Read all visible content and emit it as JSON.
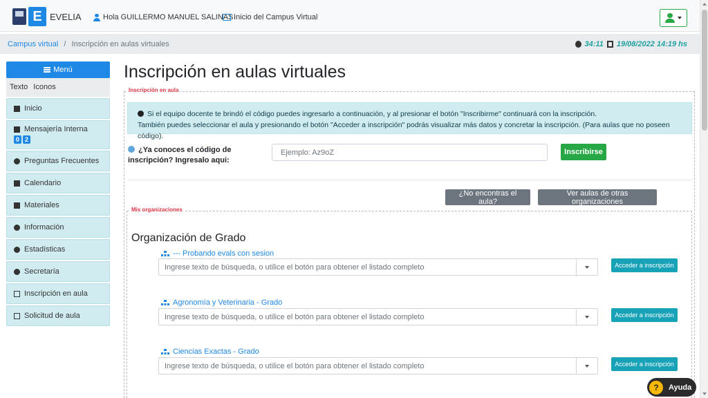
{
  "header": {
    "brand": "EVELIA",
    "greeting": "Hola GUILLERMO MANUEL SALINAS",
    "home_link": "Inicio del Campus Virtual"
  },
  "breadcrumb": {
    "root": "Campus virtual",
    "separator": "/",
    "current": "Inscripción en aulas virtuales"
  },
  "session": {
    "timer": "34:11",
    "datetime": "19/08/2022 14:19 hs"
  },
  "sidebar": {
    "menu_label": "Menú",
    "view_text": "Texto",
    "view_icons": "Iconos",
    "items": [
      {
        "label": "Inicio",
        "icon": "home-icon"
      },
      {
        "label": "Mensajería Interna",
        "icon": "envelope-icon",
        "badges": [
          "0",
          "2"
        ]
      },
      {
        "label": "Preguntas Frecuentes",
        "icon": "question-circle-icon"
      },
      {
        "label": "Calendario",
        "icon": "calendar-icon"
      },
      {
        "label": "Materiales",
        "icon": "file-icon"
      },
      {
        "label": "Información",
        "icon": "info-icon"
      },
      {
        "label": "Estadísticas",
        "icon": "pie-chart-icon"
      },
      {
        "label": "Secretaría",
        "icon": "gears-icon"
      },
      {
        "label": "Inscripción en aula",
        "icon": "screen-icon"
      },
      {
        "label": "Solicitud de aula",
        "icon": "monitor-icon"
      }
    ]
  },
  "main": {
    "title": "Inscripción en aulas virtuales",
    "section_enrollment": "Inscripción en aula",
    "info_line1": "Si el equipo docente te brindó el código puedes ingresarlo a continuación, y al presionar el botón \"Inscribirme\" continuará con la inscripción.",
    "info_line2": "También puedes seleccionar el aula y presionando el botón \"Acceder a inscripción\" podrás visualizar más datos y concretar la inscripción. (Para aulas que no poseen código).",
    "code_question": "¿Ya conoces el código de inscripción? Ingresalo aqui:",
    "code_placeholder": "Ejemplo: Az9oZ",
    "enroll_button": "Inscribirse",
    "not_found_button": "¿No encontras el aula?",
    "other_orgs_button": "Ver aulas de otras organizaciones",
    "section_orgs": "Mis organizaciones",
    "org_title": "Organización de Grado",
    "groups": [
      {
        "name": "--- Probando evals con sesion",
        "placeholder": "Ingrese texto de búsqueda, o utilice el botón para obtener el listado completo",
        "action": "Acceder a inscripción"
      },
      {
        "name": "Agronomía y Veterinaria - Grado",
        "placeholder": "Ingrese texto de búsqueda, o utilice el botón para obtener el listado completo",
        "action": "Acceder a inscripción"
      },
      {
        "name": "Ciencias Exactas - Grado",
        "placeholder": "Ingrese texto de búsqueda, o utilice el botón para obtener el listado completo",
        "action": "Acceder a inscripción"
      }
    ]
  },
  "help": {
    "label": "Ayuda",
    "icon_glyph": "?"
  }
}
